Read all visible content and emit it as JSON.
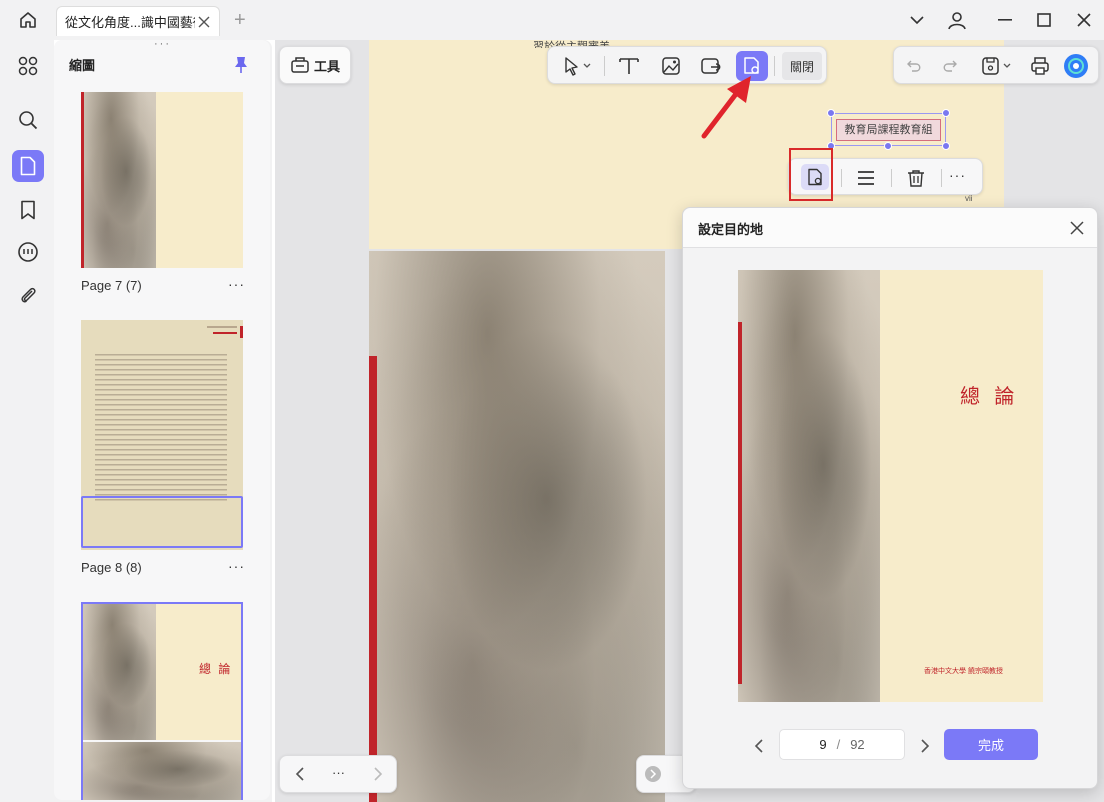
{
  "window": {
    "tab_title": "從文化角度...識中國藝術",
    "add_tab": "+"
  },
  "sidebar_panel": {
    "title": "縮圖",
    "pages": [
      {
        "label": "Page 7 (7)",
        "more": "···"
      },
      {
        "label": "Page 8 (8)",
        "more": "···"
      },
      {
        "label": "",
        "thumb_title": "總 論"
      }
    ],
    "page8_thumb_corner": "從文化角度\n中國藝術"
  },
  "toolbar": {
    "tools_label": "工具",
    "close_label": "關閉"
  },
  "canvas": {
    "top_text_partial": "習於從主觀審美",
    "link_text": "教育局課程教育組",
    "page_num_small": "vii"
  },
  "modal": {
    "title": "設定目的地",
    "preview_title": "總 論",
    "preview_author": "香港中文大學 饒宗頤教授",
    "current_page": "9",
    "separator": "/",
    "total_pages": "92",
    "done_label": "完成"
  },
  "bottom_nav": {
    "more": "···"
  },
  "colors": {
    "accent": "#7b79f7",
    "accent_border": "#5a58e6",
    "cream": "#f7eccb",
    "red": "#c0242a",
    "highlight_red": "#d92a2a"
  },
  "icons": {
    "home": "home-icon",
    "close_tab": "close-icon",
    "chevron": "chevron-down-icon",
    "account": "user-icon",
    "minimize": "minimize-icon",
    "maximize": "maximize-icon",
    "close": "close-icon"
  }
}
